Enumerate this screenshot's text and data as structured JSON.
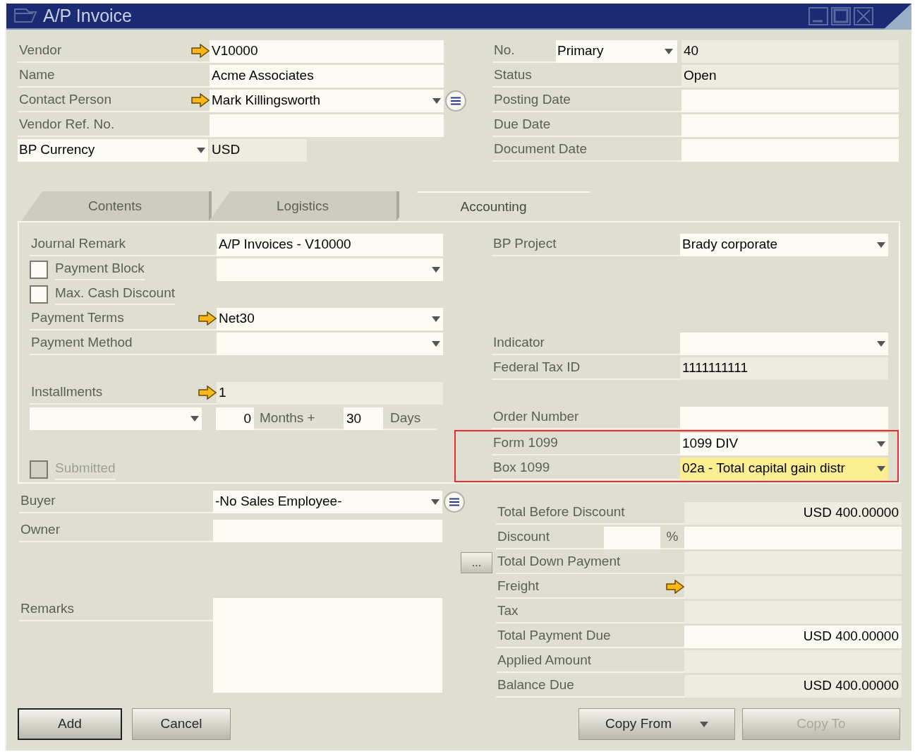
{
  "window": {
    "title": "A/P Invoice"
  },
  "header": {
    "left": [
      {
        "kind": "text",
        "label": "Vendor",
        "link": true,
        "value": "V10000"
      },
      {
        "kind": "text",
        "label": "Name",
        "value": "Acme Associates"
      },
      {
        "kind": "select",
        "label": "Contact Person",
        "link": true,
        "value": "Mark Killingsworth",
        "list_button": true
      },
      {
        "kind": "text",
        "label": "Vendor Ref. No."
      },
      {
        "kind": "select_label",
        "label": "BP Currency",
        "readonly": true,
        "value": "USD"
      }
    ],
    "right": [
      {
        "kind": "series",
        "label": "No.",
        "series": "Primary",
        "readonly": true,
        "value": "40"
      },
      {
        "kind": "text",
        "label": "Status",
        "readonly": true,
        "value": "Open"
      },
      {
        "kind": "text",
        "label": "Posting Date"
      },
      {
        "kind": "text",
        "label": "Due Date"
      },
      {
        "kind": "text",
        "label": "Document Date"
      }
    ]
  },
  "tabs": [
    {
      "label": "Contents",
      "selected": false
    },
    {
      "label": "Logistics",
      "selected": false
    },
    {
      "label": "Accounting",
      "selected": true
    }
  ],
  "accounting": {
    "left": [
      {
        "rows": [
          {
            "kind": "text",
            "label": "Journal Remark",
            "value": "A/P Invoices - V10000"
          },
          {
            "kind": "checkbox_select",
            "label": "Payment Block",
            "checked": false,
            "disabled": false
          },
          {
            "kind": "checkbox",
            "label": "Max. Cash Discount",
            "checked": false,
            "disabled": false
          },
          {
            "kind": "select",
            "label": "Payment Terms",
            "link": true,
            "value": "Net30"
          },
          {
            "kind": "select",
            "label": "Payment Method"
          }
        ]
      },
      {
        "rows": [
          {
            "kind": "text",
            "label": "Installments",
            "link": true,
            "readonly": true,
            "value": "1"
          },
          {
            "kind": "installment",
            "months": "0",
            "months_label": "Months +",
            "days": "30",
            "days_label": "Days"
          }
        ]
      },
      {
        "rows": [
          {
            "kind": "checkbox",
            "label": "Submitted",
            "checked": false,
            "disabled": true
          }
        ]
      }
    ],
    "right": [
      {
        "rows": [
          {
            "kind": "select",
            "label": "BP Project",
            "value": "Brady corporate"
          }
        ]
      },
      {
        "rows": [
          {
            "kind": "select",
            "label": "Indicator"
          },
          {
            "kind": "text",
            "label": "Federal Tax ID",
            "readonly": true,
            "value": "1111111111"
          }
        ]
      },
      {
        "rows": [
          {
            "kind": "text",
            "label": "Order Number"
          },
          {
            "kind": "select",
            "label": "Form 1099",
            "value": "1099 DIV",
            "framed": true
          },
          {
            "kind": "select",
            "label": "Box 1099",
            "value": "02a - Total capital gain distr",
            "highlighted": true,
            "framed": true
          }
        ]
      }
    ]
  },
  "bottom": {
    "left": [
      {
        "kind": "select",
        "label": "Buyer",
        "value": "-No Sales Employee-",
        "list_button": true
      },
      {
        "kind": "text",
        "label": "Owner"
      },
      {
        "kind": "memo",
        "label": "Remarks"
      }
    ],
    "totals": [
      {
        "kind": "text",
        "label": "Total Before Discount",
        "readonly": true,
        "value": "USD 400.00000"
      },
      {
        "kind": "discount",
        "label": "Discount",
        "percent_sign": "%"
      },
      {
        "kind": "text",
        "label": "Total Down Payment",
        "more_button": "...",
        "readonly": true
      },
      {
        "kind": "text",
        "label": "Freight",
        "link": true,
        "readonly": true
      },
      {
        "kind": "text",
        "label": "Tax",
        "readonly": true
      },
      {
        "kind": "text",
        "label": "Total Payment Due",
        "value": "USD 400.00000"
      },
      {
        "kind": "text",
        "label": "Applied Amount",
        "readonly": true
      },
      {
        "kind": "text",
        "label": "Balance Due",
        "readonly": true,
        "value": "USD 400.00000"
      }
    ]
  },
  "buttons": {
    "left": [
      {
        "label": "Add",
        "default": true,
        "disabled": false
      },
      {
        "label": "Cancel",
        "default": false,
        "disabled": false
      }
    ],
    "right": [
      {
        "label": "Copy From",
        "dropdown": true,
        "disabled": false
      },
      {
        "label": "Copy To",
        "dropdown": false,
        "disabled": true
      }
    ]
  }
}
